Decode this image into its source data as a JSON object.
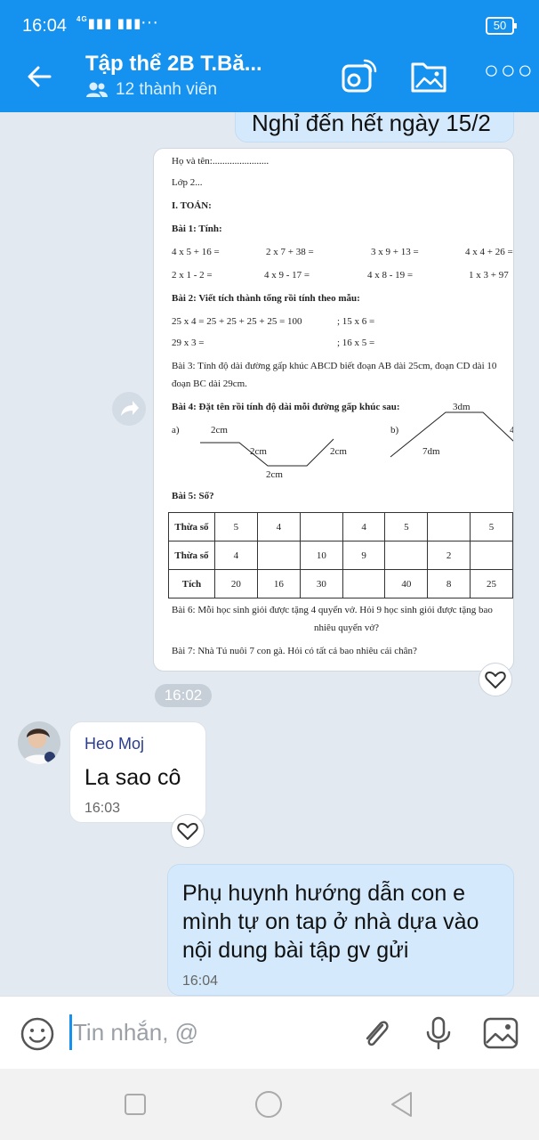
{
  "status_bar": {
    "time": "16:04",
    "signal": "4G",
    "battery": "50"
  },
  "header": {
    "title": "Tập thể 2B T.Bă...",
    "members": "12 thành viên"
  },
  "messages": {
    "partial_top": "Nghỉ đến hết ngày 15/2",
    "image_time": "16:02",
    "incoming": {
      "sender": "Heo Moj",
      "text": "La sao cô",
      "time": "16:03"
    },
    "outgoing": {
      "text": "Phụ huynh hướng dẫn con e mình tự on tap ở nhà dựa vào nội dung bài tập gv gửi",
      "time": "16:04"
    }
  },
  "worksheet": {
    "name_line": "Họ và tên:.......................",
    "class_line": "Lớp 2...",
    "section": "I. TOÁN:",
    "ex1_title": "Bài 1: Tính:",
    "ex1_row1": [
      "4 x 5 + 16 =",
      "2 x 7 + 38 =",
      "3 x 9 + 13 =",
      "4 x 4 + 26 ="
    ],
    "ex1_row2": [
      "2 x 1 - 2 =",
      "4 x 9 - 17 =",
      "4 x 8 - 19 =",
      "1 x 3 + 97"
    ],
    "ex2_title": "Bài 2: Viết tích thành tổng rồi tính theo mẫu:",
    "ex2_line1a": "25 x 4 = 25 + 25 + 25 + 25 = 100",
    "ex2_line1b": ";    15 x 6 =",
    "ex2_line2a": "29 x 3 =",
    "ex2_line2b": ";    16 x 5 =",
    "ex3_line1": "Bài 3: Tính độ dài đường gấp khúc ABCD biết đoạn AB dài 25cm, đoạn CD dài 10",
    "ex3_line2": "đoạn BC dài 29cm.",
    "ex4_title": "Bài 4: Đặt tên rồi tính độ dài mỗi đường gấp khúc sau:",
    "ex4_a": "a)",
    "ex4_b": "b)",
    "ex4_labels": {
      "a1": "2cm",
      "a2": "2cm",
      "a3": "2cm",
      "a4": "2cm",
      "b1": "3dm",
      "b2": "7dm",
      "b3": "4"
    },
    "ex5_title": "Bài 5: Số?",
    "table": {
      "rows": [
        [
          "Thừa số",
          "5",
          "4",
          "",
          "4",
          "5",
          "",
          "5"
        ],
        [
          "Thừa số",
          "4",
          "",
          "10",
          "9",
          "",
          "2",
          ""
        ],
        [
          "Tích",
          "20",
          "16",
          "30",
          "",
          "40",
          "8",
          "25"
        ]
      ]
    },
    "ex6_line1": "Bài 6: Mỗi học sinh giỏi được tặng 4 quyển vở. Hỏi 9 học sinh giỏi được tặng bao",
    "ex6_line2": "nhiêu quyển vở?",
    "ex7": "Bài 7: Nhà Tú nuôi 7 con gà. Hỏi có tất cả bao nhiêu cái chân?"
  },
  "input": {
    "placeholder": "Tin nhắn, @"
  },
  "icons": {
    "back": "arrow-left-icon",
    "call": "video-call-icon",
    "folder": "folder-image-icon",
    "more": "more-dots-icon",
    "emoji": "emoji-icon",
    "attach": "paperclip-icon",
    "mic": "microphone-icon",
    "gallery": "image-icon"
  },
  "colors": {
    "brand": "#1591f0",
    "outgoing_bubble": "#d4eafc",
    "background": "#e2e9f1"
  }
}
